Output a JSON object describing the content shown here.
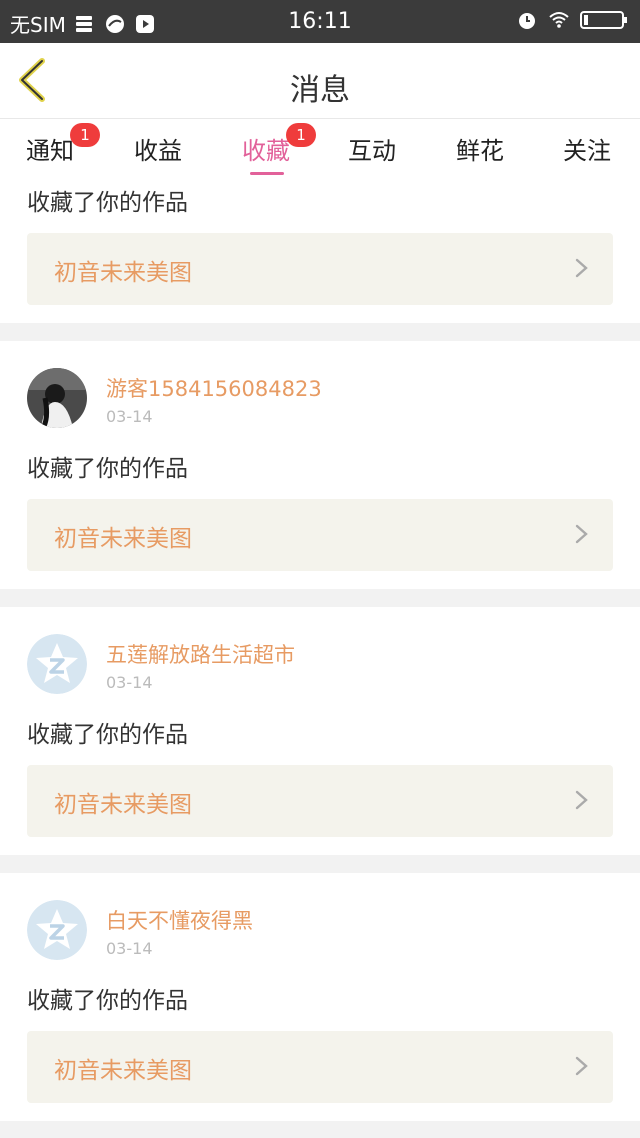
{
  "status_bar": {
    "carrier": "无SIM",
    "time": "16:11"
  },
  "nav": {
    "title": "消息"
  },
  "tabs": [
    {
      "label": "通知",
      "badge": "1"
    },
    {
      "label": "收益"
    },
    {
      "label": "收藏",
      "badge": "1",
      "active": true
    },
    {
      "label": "互动"
    },
    {
      "label": "鲜花"
    },
    {
      "label": "关注"
    }
  ],
  "feed": [
    {
      "action": "收藏了你的作品",
      "work": "初音未来美图"
    },
    {
      "user": "游客1584156084823",
      "date": "03-14",
      "action": "收藏了你的作品",
      "work": "初音未来美图"
    },
    {
      "user": "五莲解放路生活超市",
      "date": "03-14",
      "action": "收藏了你的作品",
      "work": "初音未来美图"
    },
    {
      "user": "白天不懂夜得黑",
      "date": "03-14",
      "action": "收藏了你的作品",
      "work": "初音未来美图"
    }
  ]
}
